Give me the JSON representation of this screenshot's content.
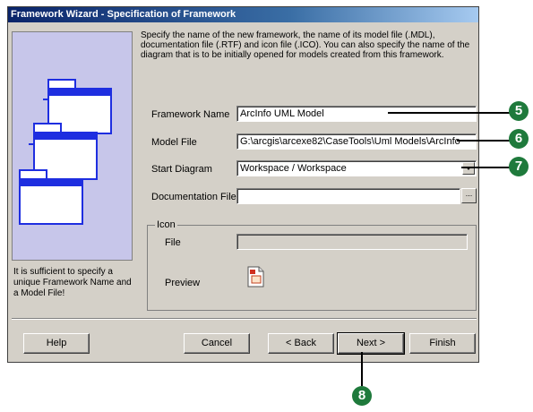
{
  "window": {
    "title": "Framework Wizard - Specification of Framework"
  },
  "intro_text": "Specify the name of the new framework, the name of its model file (.MDL), documentation file (.RTF) and icon file (.ICO). You can also specify the name of the diagram that is to be initially opened for models created from this framework.",
  "left_note": "It is sufficient to specify a unique Framework Name and a Model File!",
  "form": {
    "framework_name": {
      "label": "Framework Name",
      "value": "ArcInfo UML Model"
    },
    "model_file": {
      "label": "Model File",
      "value": "G:\\arcgis\\arcexe82\\CaseTools\\Uml Models\\ArcInfo"
    },
    "start_diagram": {
      "label": "Start Diagram",
      "value": "Workspace / Workspace"
    },
    "documentation_file": {
      "label": "Documentation File",
      "value": "",
      "browse_label": "..."
    }
  },
  "icon_group": {
    "title": "Icon",
    "file_label": "File",
    "file_value": "",
    "preview_label": "Preview"
  },
  "buttons": {
    "help": "Help",
    "cancel": "Cancel",
    "back": "< Back",
    "next": "Next >",
    "finish": "Finish"
  },
  "callouts": {
    "c5": "5",
    "c6": "6",
    "c7": "7",
    "c8": "8"
  },
  "colors": {
    "title_bar": "#0a246a",
    "panel_bg": "#c7c6ea",
    "dialog_bg": "#d4d0c8",
    "callout": "#1f7a3c",
    "folder_fill": "#1e2ee0"
  }
}
